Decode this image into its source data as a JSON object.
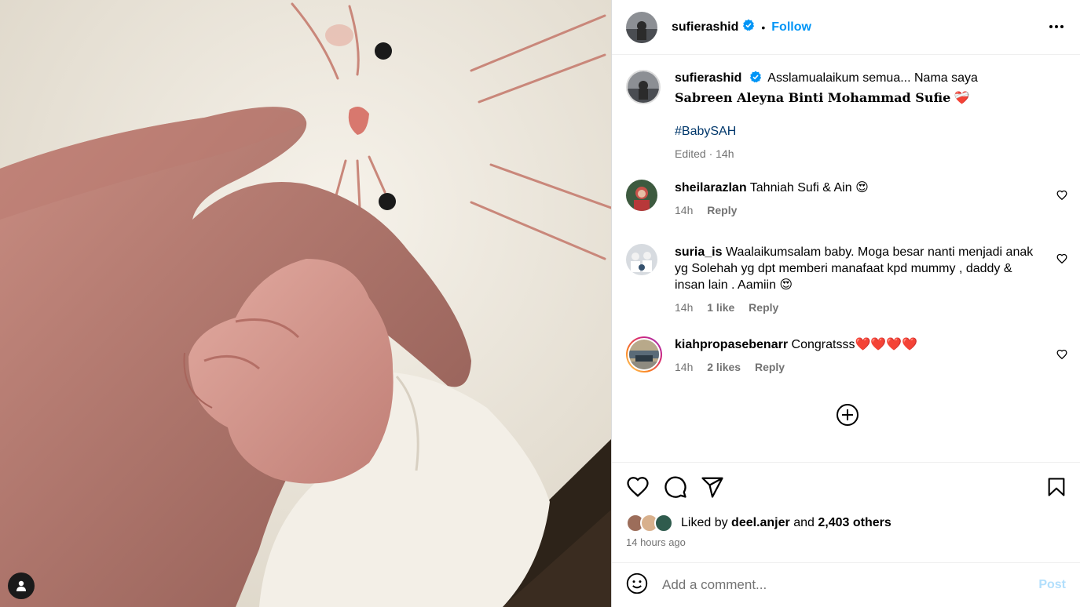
{
  "post": {
    "author": "sufierashid",
    "follow_label": "Follow",
    "separator": "•"
  },
  "caption": {
    "author": "sufierashid",
    "text": "Asslamualaikum semua... Nama saya",
    "name_line": "Sabreen Aleyna Binti Mohammad Sufie",
    "name_emoji": "❤️‍🩹",
    "hashtag": "#BabySAH",
    "meta": "Edited · 14h"
  },
  "comments": [
    {
      "user": "sheilarazlan",
      "text": "Tahniah Sufi & Ain 😍",
      "time": "14h",
      "likes": "",
      "reply": "Reply"
    },
    {
      "user": "suria_is",
      "text": "Waalaikumsalam baby. Moga besar nanti menjadi anak yg Solehah yg dpt memberi manafaat kpd mummy , daddy & insan lain . Aamiin 😍",
      "time": "14h",
      "likes": "1 like",
      "reply": "Reply"
    },
    {
      "user": "kiahpropasebenarr",
      "text": "Congratsss❤️❤️❤️❤️",
      "time": "14h",
      "likes": "2 likes",
      "reply": "Reply"
    }
  ],
  "likes": {
    "prefix": "Liked by",
    "user": "deel.anjer",
    "and": "and",
    "others": "2,403 others"
  },
  "time_ago": "14 hours ago",
  "add_comment": {
    "placeholder": "Add a comment...",
    "post_label": "Post"
  },
  "icons": {
    "verified": "verified-badge-icon",
    "more": "more-options-icon",
    "like": "heart-icon",
    "comment": "comment-icon",
    "share": "share-icon",
    "save": "bookmark-icon",
    "emoji": "emoji-icon",
    "load_more": "plus-circle-icon",
    "user_tag": "person-tag-icon"
  },
  "colors": {
    "accent": "#0095f6",
    "hashtag": "#00376b",
    "muted": "#737373",
    "post_disabled": "#b2dffc"
  }
}
